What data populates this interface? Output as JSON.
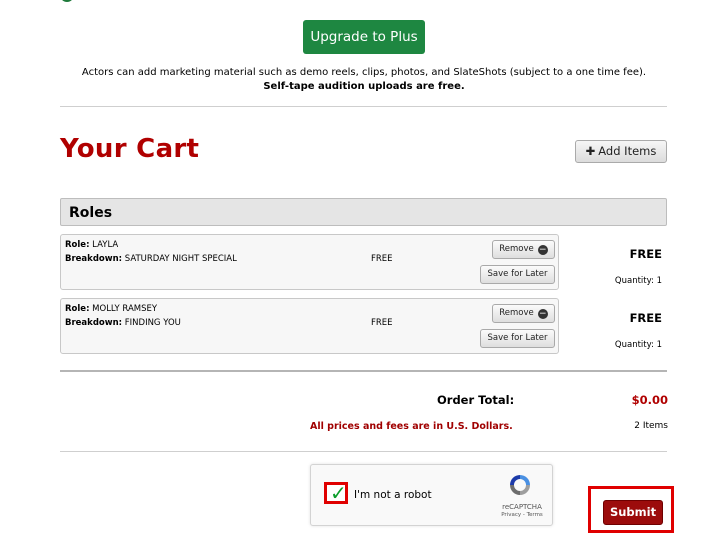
{
  "upgrade": {
    "label": "Upgrade to Plus"
  },
  "info": {
    "line1": "Actors can add marketing material such as demo reels, clips, photos, and SlateShots (subject to a one time fee).",
    "line2": "Self-tape audition uploads are free."
  },
  "cart": {
    "title": "Your Cart",
    "add_items_label": "Add Items"
  },
  "roles": {
    "header": "Roles",
    "role_label": "Role:",
    "breakdown_label": "Breakdown:",
    "remove_label": "Remove",
    "save_later_label": "Save for Later",
    "items": [
      {
        "role": "LAYLA",
        "breakdown": "SATURDAY NIGHT SPECIAL",
        "fee": "FREE",
        "price": "FREE",
        "quantity": "Quantity: 1"
      },
      {
        "role": "MOLLY RAMSEY",
        "breakdown": "FINDING YOU",
        "fee": "FREE",
        "price": "FREE",
        "quantity": "Quantity: 1"
      }
    ]
  },
  "order": {
    "total_label": "Order Total:",
    "total_value": "$0.00",
    "currency_note": "All prices and fees are in U.S. Dollars.",
    "items_count": "2 Items"
  },
  "captcha": {
    "label": "I'm not a robot",
    "brand": "reCAPTCHA",
    "links": "Privacy - Terms",
    "checked": true
  },
  "submit": {
    "label": "Submit"
  },
  "colors": {
    "upgrade_green": "#1e8741",
    "cart_red": "#b00000",
    "submit_red": "#9c0c0c",
    "highlight_red": "#e00000"
  }
}
